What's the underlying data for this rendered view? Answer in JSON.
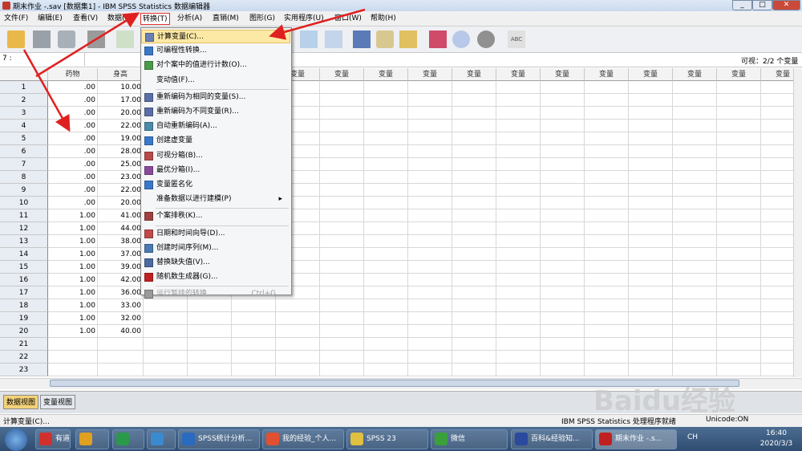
{
  "window": {
    "title": "期末作业 -.sav [数据集1] - IBM SPSS Statistics 数据编辑器",
    "minimize": "_",
    "maximize": "□",
    "close": "✕"
  },
  "menubar": [
    "文件(F)",
    "编辑(E)",
    "查看(V)",
    "数据(D)",
    "转换(T)",
    "分析(A)",
    "直销(M)",
    "图形(G)",
    "实用程序(U)",
    "窗口(W)",
    "帮助(H)"
  ],
  "active_menu": "转换(T)",
  "cellbar": {
    "ref": "7 :",
    "visible": "可视：2/2 个变量"
  },
  "grid": {
    "columns": [
      "药物",
      "身高",
      "变量",
      "变量",
      "变量",
      "变量",
      "变量",
      "变量",
      "变量",
      "变量",
      "变量",
      "变量",
      "变量",
      "变量",
      "变量",
      "变量",
      "变量"
    ],
    "rows": [
      [
        "1",
        ".00",
        "10.00"
      ],
      [
        "2",
        ".00",
        "17.00"
      ],
      [
        "3",
        ".00",
        "20.00"
      ],
      [
        "4",
        ".00",
        "22.00"
      ],
      [
        "5",
        ".00",
        "19.00"
      ],
      [
        "6",
        ".00",
        "28.00"
      ],
      [
        "7",
        ".00",
        "25.00"
      ],
      [
        "8",
        ".00",
        "23.00"
      ],
      [
        "9",
        ".00",
        "22.00"
      ],
      [
        "10",
        ".00",
        "20.00"
      ],
      [
        "11",
        "1.00",
        "41.00"
      ],
      [
        "12",
        "1.00",
        "44.00"
      ],
      [
        "13",
        "1.00",
        "38.00"
      ],
      [
        "14",
        "1.00",
        "37.00"
      ],
      [
        "15",
        "1.00",
        "39.00"
      ],
      [
        "16",
        "1.00",
        "42.00"
      ],
      [
        "17",
        "1.00",
        "36.00"
      ],
      [
        "18",
        "1.00",
        "33.00"
      ],
      [
        "19",
        "1.00",
        "32.00"
      ],
      [
        "20",
        "1.00",
        "40.00"
      ],
      [
        "21",
        "",
        ""
      ],
      [
        "22",
        "",
        ""
      ],
      [
        "23",
        "",
        ""
      ]
    ]
  },
  "dropdown": [
    {
      "label": "计算变量(C)...",
      "icon": "calculator-icon",
      "color": "#6a7fb5",
      "highlighted": true
    },
    {
      "label": "可编程性转换...",
      "icon": "plus-icon",
      "color": "#3a78c9"
    },
    {
      "label": "对个案中的值进行计数(O)...",
      "icon": "count-icon",
      "color": "#4a9a4a"
    },
    {
      "label": "变动值(F)...",
      "icon": "",
      "color": ""
    },
    {
      "sep": true
    },
    {
      "label": "重新编码为相同的变量(S)...",
      "icon": "recode-icon",
      "color": "#5a6fa5"
    },
    {
      "label": "重新编码为不同变量(R)...",
      "icon": "recode-icon",
      "color": "#5a6fa5"
    },
    {
      "label": "自动重新编码(A)...",
      "icon": "auto-recode-icon",
      "color": "#4a8aaa"
    },
    {
      "label": "创建虚变量",
      "icon": "plus-icon",
      "color": "#3a78c9"
    },
    {
      "label": "可视分箱(B)...",
      "icon": "bin-icon",
      "color": "#b84a4a"
    },
    {
      "label": "最优分箱(I)...",
      "icon": "optimal-bin-icon",
      "color": "#8a4a9a"
    },
    {
      "label": "变量匿名化",
      "icon": "plus-icon",
      "color": "#3a78c9"
    },
    {
      "label": "准备数据以进行建模(P)",
      "icon": "",
      "color": "",
      "submenu": true
    },
    {
      "sep": true
    },
    {
      "label": "个案排秩(K)...",
      "icon": "rank-icon",
      "color": "#a04040"
    },
    {
      "sep": true
    },
    {
      "label": "日期和时间向导(D)...",
      "icon": "calendar-icon",
      "color": "#c04a4a"
    },
    {
      "label": "创建时间序列(M)...",
      "icon": "timeseries-icon",
      "color": "#4a7ab0"
    },
    {
      "label": "替换缺失值(V)...",
      "icon": "missing-icon",
      "color": "#4a6aa0"
    },
    {
      "label": "随机数生成器(G)...",
      "icon": "dice-icon",
      "color": "#c02020"
    },
    {
      "sep": true
    },
    {
      "label": "运行暂挂的转换",
      "icon": "pending-icon",
      "color": "#9a9a9a",
      "disabled": true,
      "shortcut": "Ctrl+G"
    }
  ],
  "tabs": {
    "data_view": "数据视图",
    "variable_view": "变量视图"
  },
  "statusbar": {
    "left": "计算变量(C)...",
    "right1": "IBM SPSS Statistics 处理程序就绪",
    "right2": "Unicode:ON"
  },
  "taskbar": {
    "items": [
      {
        "label": "有道",
        "color": "#d0312d"
      },
      {
        "label": "",
        "color": "#e0a020"
      },
      {
        "label": "",
        "color": "#2a9a4a"
      },
      {
        "label": "",
        "color": "#3a8ad0"
      },
      {
        "label": "SPSS统计分析...",
        "color": "#2a6ac0"
      },
      {
        "label": "我的经验_个人...",
        "color": "#e05030"
      },
      {
        "label": "SPSS 23",
        "color": "#e0c040"
      },
      {
        "label": "微信",
        "color": "#3aa03a"
      },
      {
        "label": "百科&经验知...",
        "color": "#2a4aa0"
      },
      {
        "label": "期末作业 -.s...",
        "color": "#c02020"
      }
    ],
    "time": "16:40",
    "date": "2020/3/3",
    "lang": "CH"
  },
  "watermark": "Baidu经验"
}
